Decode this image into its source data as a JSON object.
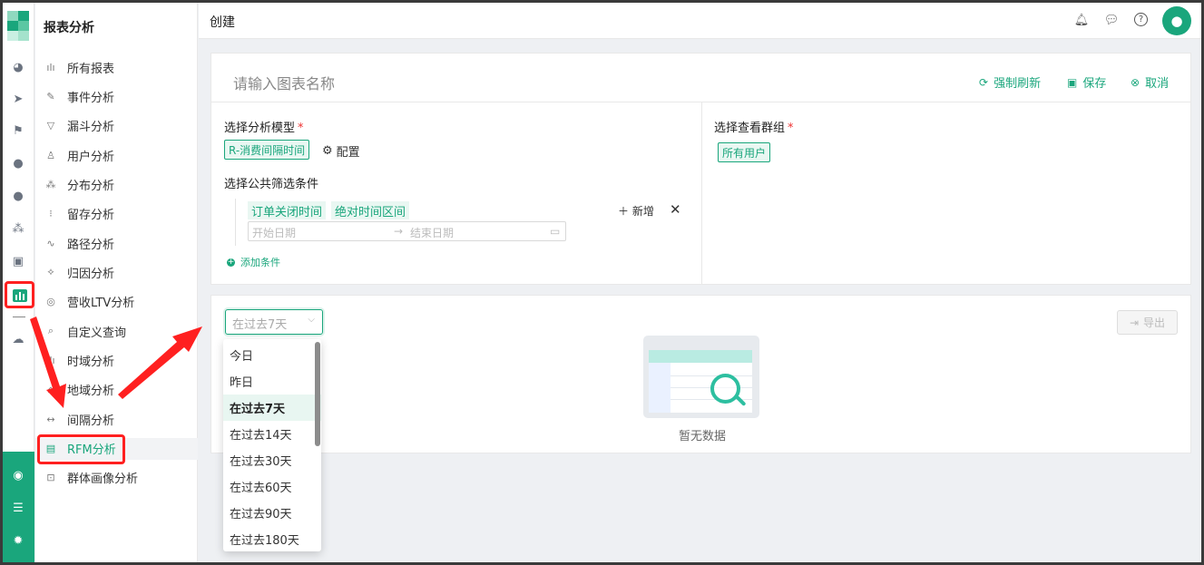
{
  "header": {
    "title": "创建"
  },
  "menu": {
    "title": "报表分析",
    "items": [
      {
        "label": "所有报表",
        "icon": "bar-chart-icon"
      },
      {
        "label": "事件分析",
        "icon": "edit-icon"
      },
      {
        "label": "漏斗分析",
        "icon": "funnel-icon"
      },
      {
        "label": "用户分析",
        "icon": "user-icon"
      },
      {
        "label": "分布分析",
        "icon": "distribution-icon"
      },
      {
        "label": "留存分析",
        "icon": "dots-icon"
      },
      {
        "label": "路径分析",
        "icon": "path-icon"
      },
      {
        "label": "归因分析",
        "icon": "attribution-icon"
      },
      {
        "label": "营收LTV分析",
        "icon": "revenue-icon"
      },
      {
        "label": "自定义查询",
        "icon": "query-icon"
      },
      {
        "label": "时域分析",
        "icon": "time-icon"
      },
      {
        "label": "地域分析",
        "icon": "region-icon"
      },
      {
        "label": "间隔分析",
        "icon": "interval-icon"
      },
      {
        "label": "RFM分析",
        "icon": "rfm-icon"
      },
      {
        "label": "群体画像分析",
        "icon": "portrait-icon"
      }
    ],
    "active_index": 13
  },
  "toolbar": {
    "name_placeholder": "请输入图表名称",
    "refresh_label": "强制刷新",
    "save_label": "保存",
    "cancel_label": "取消"
  },
  "model": {
    "label": "选择分析模型",
    "required_mark": "*",
    "selected": "R-消费间隔时间",
    "config_label": "配置"
  },
  "group": {
    "label": "选择查看群组",
    "required_mark": "*",
    "selected": "所有用户"
  },
  "filter": {
    "label": "选择公共筛选条件",
    "field": "订单关闭时间",
    "mode": "绝对时间区间",
    "add_label": "新增",
    "start_placeholder": "开始日期",
    "end_placeholder": "结束日期",
    "add_condition_label": "添加条件"
  },
  "result": {
    "range_value": "在过去7天",
    "export_label": "导出",
    "empty_text": "暂无数据"
  },
  "range_options": [
    "今日",
    "昨日",
    "在过去7天",
    "在过去14天",
    "在过去30天",
    "在过去60天",
    "在过去90天",
    "在过去180天"
  ],
  "range_selected_index": 2,
  "colors": {
    "accent": "#1aa67c",
    "annotation": "#ff2020"
  }
}
